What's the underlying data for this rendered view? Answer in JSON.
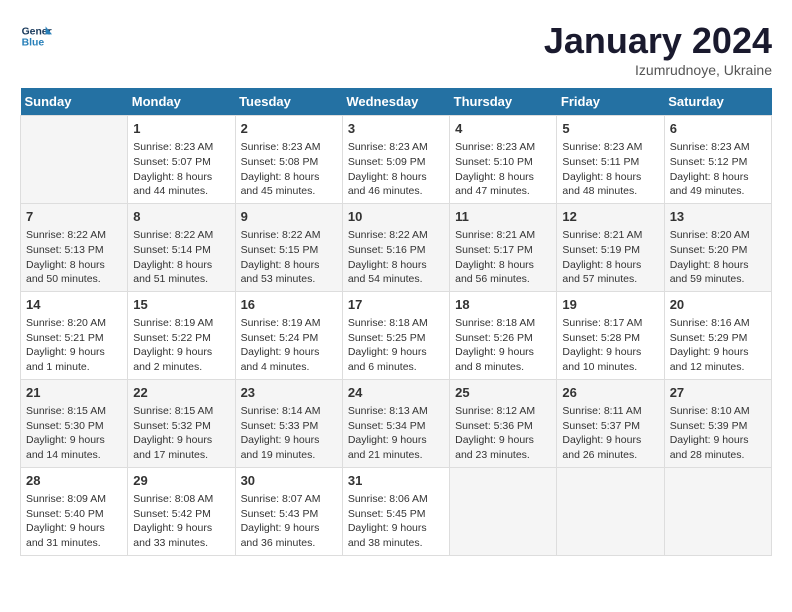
{
  "header": {
    "logo_line1": "General",
    "logo_line2": "Blue",
    "month": "January 2024",
    "location": "Izumrudnoye, Ukraine"
  },
  "weekdays": [
    "Sunday",
    "Monday",
    "Tuesday",
    "Wednesday",
    "Thursday",
    "Friday",
    "Saturday"
  ],
  "weeks": [
    [
      {
        "day": "",
        "info": ""
      },
      {
        "day": "1",
        "info": "Sunrise: 8:23 AM\nSunset: 5:07 PM\nDaylight: 8 hours\nand 44 minutes."
      },
      {
        "day": "2",
        "info": "Sunrise: 8:23 AM\nSunset: 5:08 PM\nDaylight: 8 hours\nand 45 minutes."
      },
      {
        "day": "3",
        "info": "Sunrise: 8:23 AM\nSunset: 5:09 PM\nDaylight: 8 hours\nand 46 minutes."
      },
      {
        "day": "4",
        "info": "Sunrise: 8:23 AM\nSunset: 5:10 PM\nDaylight: 8 hours\nand 47 minutes."
      },
      {
        "day": "5",
        "info": "Sunrise: 8:23 AM\nSunset: 5:11 PM\nDaylight: 8 hours\nand 48 minutes."
      },
      {
        "day": "6",
        "info": "Sunrise: 8:23 AM\nSunset: 5:12 PM\nDaylight: 8 hours\nand 49 minutes."
      }
    ],
    [
      {
        "day": "7",
        "info": "Sunrise: 8:22 AM\nSunset: 5:13 PM\nDaylight: 8 hours\nand 50 minutes."
      },
      {
        "day": "8",
        "info": "Sunrise: 8:22 AM\nSunset: 5:14 PM\nDaylight: 8 hours\nand 51 minutes."
      },
      {
        "day": "9",
        "info": "Sunrise: 8:22 AM\nSunset: 5:15 PM\nDaylight: 8 hours\nand 53 minutes."
      },
      {
        "day": "10",
        "info": "Sunrise: 8:22 AM\nSunset: 5:16 PM\nDaylight: 8 hours\nand 54 minutes."
      },
      {
        "day": "11",
        "info": "Sunrise: 8:21 AM\nSunset: 5:17 PM\nDaylight: 8 hours\nand 56 minutes."
      },
      {
        "day": "12",
        "info": "Sunrise: 8:21 AM\nSunset: 5:19 PM\nDaylight: 8 hours\nand 57 minutes."
      },
      {
        "day": "13",
        "info": "Sunrise: 8:20 AM\nSunset: 5:20 PM\nDaylight: 8 hours\nand 59 minutes."
      }
    ],
    [
      {
        "day": "14",
        "info": "Sunrise: 8:20 AM\nSunset: 5:21 PM\nDaylight: 9 hours\nand 1 minute."
      },
      {
        "day": "15",
        "info": "Sunrise: 8:19 AM\nSunset: 5:22 PM\nDaylight: 9 hours\nand 2 minutes."
      },
      {
        "day": "16",
        "info": "Sunrise: 8:19 AM\nSunset: 5:24 PM\nDaylight: 9 hours\nand 4 minutes."
      },
      {
        "day": "17",
        "info": "Sunrise: 8:18 AM\nSunset: 5:25 PM\nDaylight: 9 hours\nand 6 minutes."
      },
      {
        "day": "18",
        "info": "Sunrise: 8:18 AM\nSunset: 5:26 PM\nDaylight: 9 hours\nand 8 minutes."
      },
      {
        "day": "19",
        "info": "Sunrise: 8:17 AM\nSunset: 5:28 PM\nDaylight: 9 hours\nand 10 minutes."
      },
      {
        "day": "20",
        "info": "Sunrise: 8:16 AM\nSunset: 5:29 PM\nDaylight: 9 hours\nand 12 minutes."
      }
    ],
    [
      {
        "day": "21",
        "info": "Sunrise: 8:15 AM\nSunset: 5:30 PM\nDaylight: 9 hours\nand 14 minutes."
      },
      {
        "day": "22",
        "info": "Sunrise: 8:15 AM\nSunset: 5:32 PM\nDaylight: 9 hours\nand 17 minutes."
      },
      {
        "day": "23",
        "info": "Sunrise: 8:14 AM\nSunset: 5:33 PM\nDaylight: 9 hours\nand 19 minutes."
      },
      {
        "day": "24",
        "info": "Sunrise: 8:13 AM\nSunset: 5:34 PM\nDaylight: 9 hours\nand 21 minutes."
      },
      {
        "day": "25",
        "info": "Sunrise: 8:12 AM\nSunset: 5:36 PM\nDaylight: 9 hours\nand 23 minutes."
      },
      {
        "day": "26",
        "info": "Sunrise: 8:11 AM\nSunset: 5:37 PM\nDaylight: 9 hours\nand 26 minutes."
      },
      {
        "day": "27",
        "info": "Sunrise: 8:10 AM\nSunset: 5:39 PM\nDaylight: 9 hours\nand 28 minutes."
      }
    ],
    [
      {
        "day": "28",
        "info": "Sunrise: 8:09 AM\nSunset: 5:40 PM\nDaylight: 9 hours\nand 31 minutes."
      },
      {
        "day": "29",
        "info": "Sunrise: 8:08 AM\nSunset: 5:42 PM\nDaylight: 9 hours\nand 33 minutes."
      },
      {
        "day": "30",
        "info": "Sunrise: 8:07 AM\nSunset: 5:43 PM\nDaylight: 9 hours\nand 36 minutes."
      },
      {
        "day": "31",
        "info": "Sunrise: 8:06 AM\nSunset: 5:45 PM\nDaylight: 9 hours\nand 38 minutes."
      },
      {
        "day": "",
        "info": ""
      },
      {
        "day": "",
        "info": ""
      },
      {
        "day": "",
        "info": ""
      }
    ]
  ]
}
